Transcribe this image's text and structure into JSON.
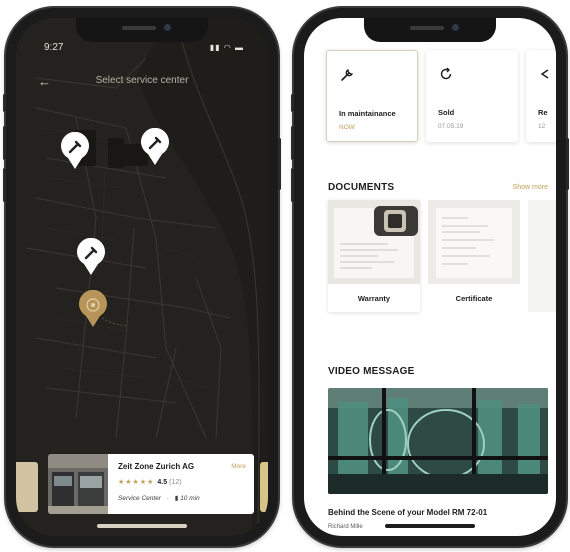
{
  "map_screen": {
    "status_time": "9:27",
    "status_icons": "▮▮ ◠ ▬",
    "header": {
      "back_glyph": "←",
      "title": "Select service center"
    },
    "card": {
      "name": "Zeit Zone Zurich AG",
      "more": "More",
      "stars": "★★★★★",
      "rating": "4.5",
      "count": "(12)",
      "type": "Service Center",
      "distance": "10 min",
      "distance_glyph": "▮"
    },
    "colors": {
      "map_bg": "#24221e",
      "pin_white": "#ffffff",
      "pin_gold": "#b8945a"
    }
  },
  "app_screen": {
    "status_cards": [
      {
        "label": "In maintainance",
        "sub": "NOW",
        "icon": "wrench-icon"
      },
      {
        "label": "Sold",
        "sub": "07.05.19",
        "icon": "refresh-icon"
      },
      {
        "label": "Re",
        "sub": "12",
        "icon": "tag-icon"
      }
    ],
    "documents": {
      "title": "DOCUMENTS",
      "show_more": "Show more",
      "items": [
        {
          "label": "Warranty"
        },
        {
          "label": "Certificate"
        }
      ]
    },
    "video": {
      "title": "VIDEO MESSAGE",
      "caption": "Behind the Scene of your Model RM 72-01",
      "author": "Richard Mille"
    },
    "colors": {
      "accent": "#c2a05a",
      "text": "#1d1d1d"
    }
  }
}
